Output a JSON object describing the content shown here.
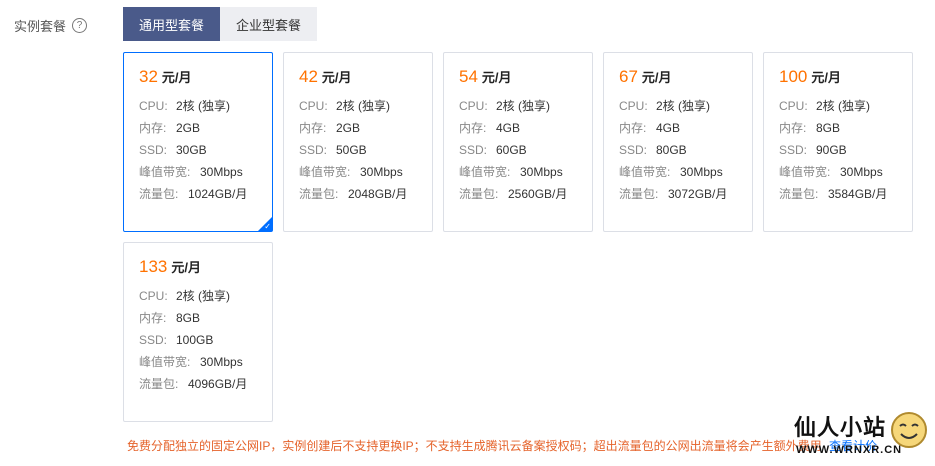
{
  "section_label": "实例套餐",
  "tabs": [
    {
      "label": "通用型套餐",
      "active": true
    },
    {
      "label": "企业型套餐",
      "active": false
    }
  ],
  "plans": [
    {
      "price": "32",
      "unit": "元/月",
      "cpu": "2核 (独享)",
      "memory": "2GB",
      "ssd": "30GB",
      "bandwidth": "30Mbps",
      "traffic": "1024GB/月",
      "selected": true
    },
    {
      "price": "42",
      "unit": "元/月",
      "cpu": "2核 (独享)",
      "memory": "2GB",
      "ssd": "50GB",
      "bandwidth": "30Mbps",
      "traffic": "2048GB/月",
      "selected": false
    },
    {
      "price": "54",
      "unit": "元/月",
      "cpu": "2核 (独享)",
      "memory": "4GB",
      "ssd": "60GB",
      "bandwidth": "30Mbps",
      "traffic": "2560GB/月",
      "selected": false
    },
    {
      "price": "67",
      "unit": "元/月",
      "cpu": "2核 (独享)",
      "memory": "4GB",
      "ssd": "80GB",
      "bandwidth": "30Mbps",
      "traffic": "3072GB/月",
      "selected": false
    },
    {
      "price": "100",
      "unit": "元/月",
      "cpu": "2核 (独享)",
      "memory": "8GB",
      "ssd": "90GB",
      "bandwidth": "30Mbps",
      "traffic": "3584GB/月",
      "selected": false
    },
    {
      "price": "133",
      "unit": "元/月",
      "cpu": "2核 (独享)",
      "memory": "8GB",
      "ssd": "100GB",
      "bandwidth": "30Mbps",
      "traffic": "4096GB/月",
      "selected": false
    }
  ],
  "spec_labels": {
    "cpu": "CPU:",
    "memory": "内存:",
    "ssd": "SSD:",
    "bandwidth": "峰值带宽:",
    "traffic": "流量包:"
  },
  "notice": "免费分配独立的固定公网IP，实例创建后不支持更换IP；不支持生成腾讯云备案授权码；超出流量包的公网出流量将会产生额外费用",
  "notice_link": "查看计价",
  "watermark": {
    "title": "仙人小站",
    "url": "WWW.WRNXR.CN"
  },
  "colors": {
    "accent": "#006eff",
    "price": "#ff7200",
    "tab_active": "#4a5a8a",
    "notice": "#e5632b"
  }
}
